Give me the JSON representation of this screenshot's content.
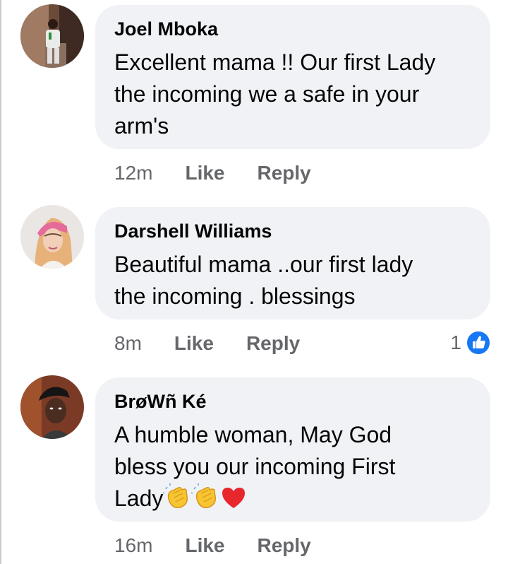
{
  "comments": [
    {
      "author": "Joel Mboka",
      "lines": [
        "Excellent mama !! Our first Lady",
        "the incoming  we a safe in your",
        "arm's"
      ],
      "time": "12m",
      "like_label": "Like",
      "reply_label": "Reply",
      "avatar_icon": "person-photo-icon"
    },
    {
      "author": "Darshell Williams",
      "lines": [
        "Beautiful mama ..our first lady",
        "the incoming . blessings"
      ],
      "time": "8m",
      "like_label": "Like",
      "reply_label": "Reply",
      "reaction_count": "1",
      "reaction_icon": "like-reaction-icon",
      "avatar_icon": "woman-photo-icon"
    },
    {
      "author": "BrøWñ Ké",
      "lines": [
        "A humble woman, May God",
        "bless you our incoming First",
        "Lady"
      ],
      "emojis": [
        "clapping-hands-icon",
        "clapping-hands-icon",
        "red-heart-icon"
      ],
      "time": "16m",
      "like_label": "Like",
      "reply_label": "Reply",
      "avatar_icon": "man-photo-icon"
    }
  ],
  "colors": {
    "bubble": "#f0f2f5",
    "secondary_text": "#65676b",
    "like_blue": "#1877f2",
    "heart_red": "#e8262e",
    "clap_yellow": "#f7c531"
  }
}
